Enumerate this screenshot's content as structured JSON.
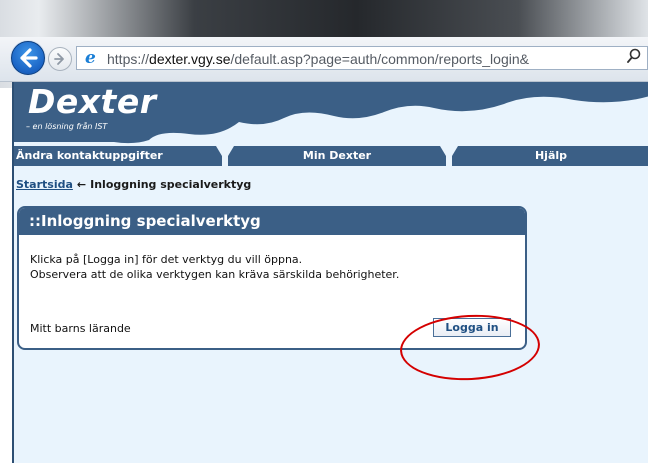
{
  "browser": {
    "url_prefix": "https://",
    "url_domain": "dexter.vgy.se",
    "url_path": "/default.asp?page=auth/common/reports_login&",
    "icons": {
      "back": "back-arrow-icon",
      "forward": "forward-arrow-icon",
      "site": "ie-icon",
      "search": "search-icon"
    }
  },
  "header": {
    "logo": "Dexter",
    "tagline": "– en lösning från IST"
  },
  "nav": {
    "tabs": [
      {
        "label": "Ändra kontaktuppgifter"
      },
      {
        "label": "Min Dexter"
      },
      {
        "label": "Hjälp"
      }
    ]
  },
  "breadcrumb": {
    "home": "Startsida",
    "separator": "←",
    "current": "Inloggning specialverktyg"
  },
  "panel": {
    "title": "::Inloggning specialverktyg",
    "line1": "Klicka på [Logga in] för det verktyg du vill öppna.",
    "line2": "Observera att de olika verktygen kan kräva särskilda behörigheter.",
    "tool": "Mitt barns lärande",
    "button": "Logga in"
  },
  "colors": {
    "header_blue": "#3b5f86",
    "page_bg": "#e9f4fd",
    "annotation_red": "#d40000"
  }
}
